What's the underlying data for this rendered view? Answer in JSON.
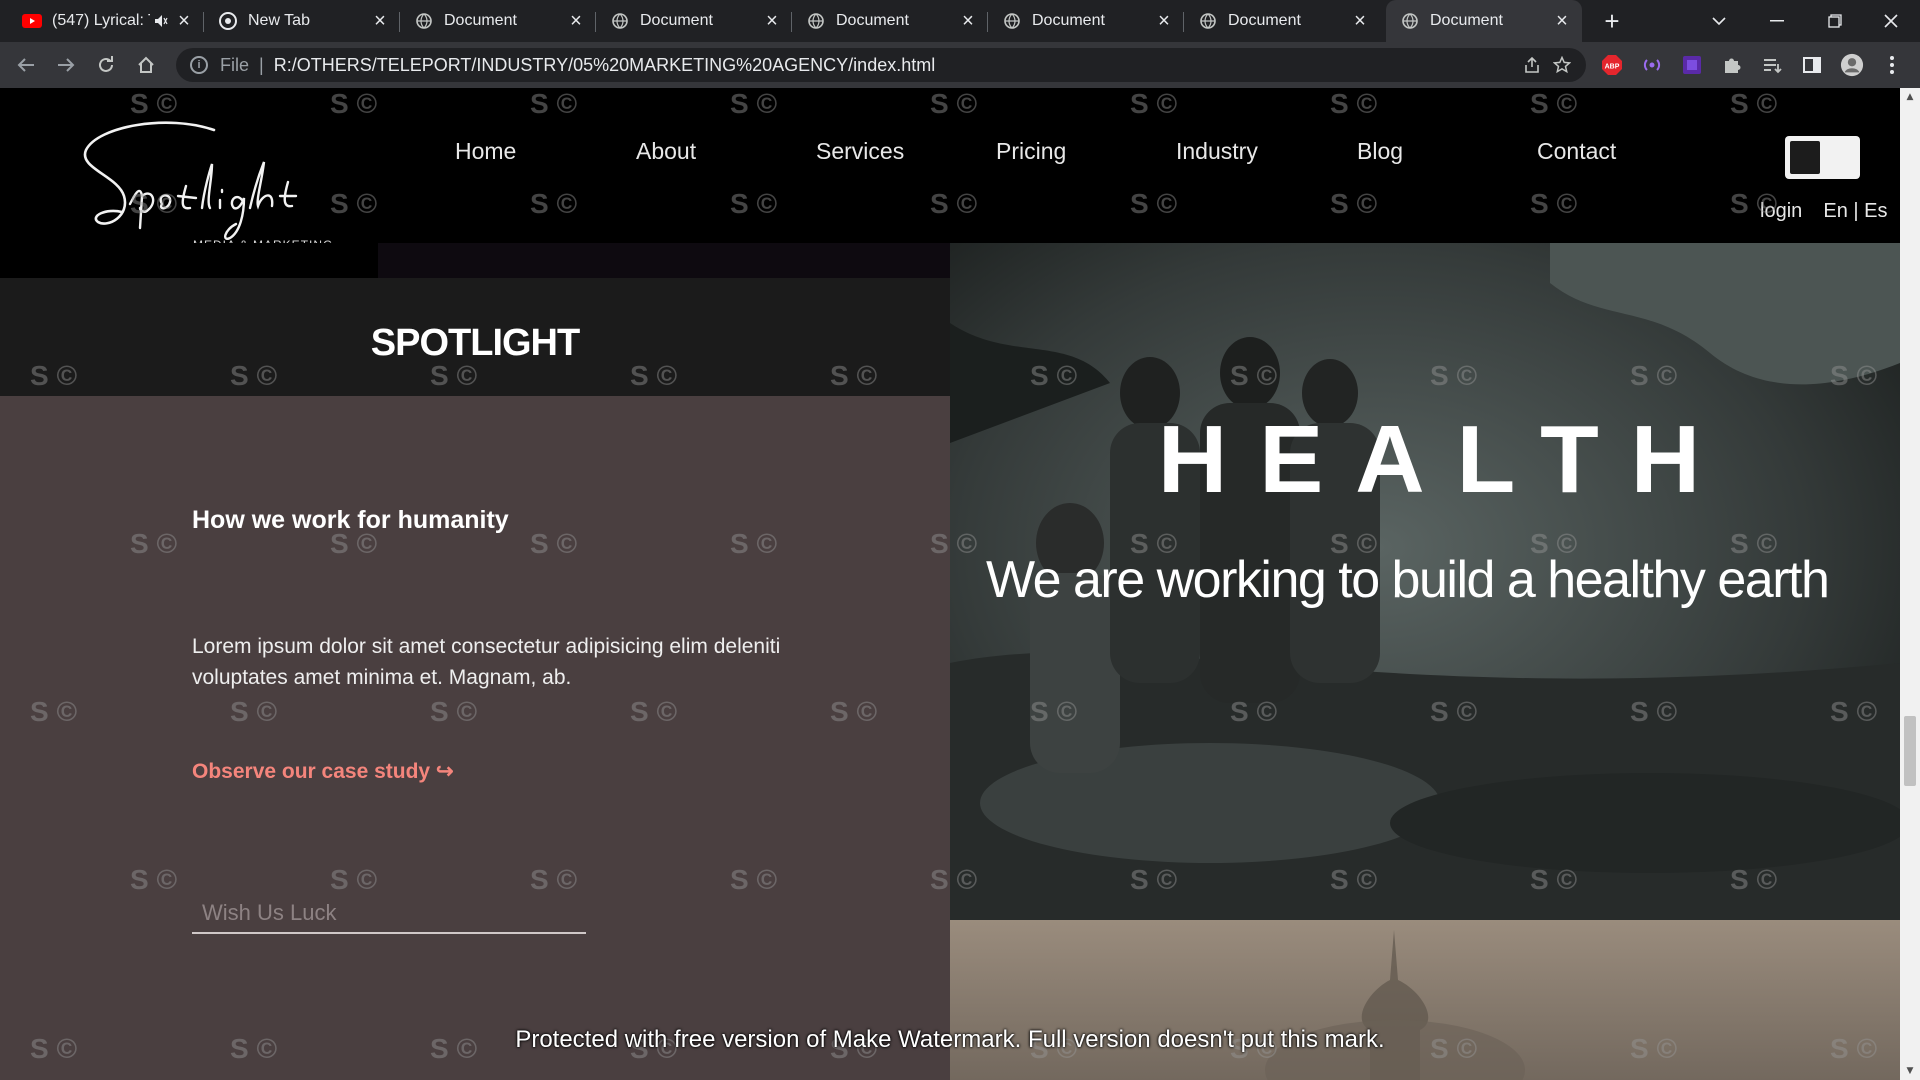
{
  "browser": {
    "tabs": [
      {
        "title": "(547) Lyrical: Te",
        "kind": "youtube"
      },
      {
        "title": "New Tab",
        "kind": "chrome"
      },
      {
        "title": "Document",
        "kind": "globe"
      },
      {
        "title": "Document",
        "kind": "globe"
      },
      {
        "title": "Document",
        "kind": "globe"
      },
      {
        "title": "Document",
        "kind": "globe"
      },
      {
        "title": "Document",
        "kind": "globe"
      },
      {
        "title": "Document",
        "kind": "globe"
      }
    ],
    "active_tab_index": 7,
    "address": {
      "scheme_label": "File",
      "separator": "|",
      "url": "R:/OTHERS/TELEPORT/INDUSTRY/05%20MARKETING%20AGENCY/index.html"
    },
    "extensions": [
      {
        "name": "adblock-plus-icon",
        "label": "ABP",
        "color": "#e5262d"
      },
      {
        "name": "broadcast-icon",
        "color": "#7b42d9"
      },
      {
        "name": "purple-extension-icon",
        "color": "#5a2aa8"
      },
      {
        "name": "puzzle-icon",
        "color": "#c4c7c5"
      }
    ]
  },
  "site": {
    "logo_script": "Spotlight",
    "logo_sub": "MEDIA & MARKETING",
    "nav": [
      "Home",
      "About",
      "Services",
      "Pricing",
      "Industry",
      "Blog",
      "Contact"
    ],
    "login": "login",
    "lang": "En | Es",
    "spotlight_title": "SPOTLIGHT",
    "section": {
      "heading": "How we work for humanity",
      "body": "Lorem ipsum dolor sit amet consectetur adipisicing elim deleniti voluptates amet minima et. Magnam, ab.",
      "link": "Observe our case study ↪",
      "input_placeholder": "Wish Us Luck"
    },
    "hero": {
      "title": "HEALTH",
      "subtitle": "We are working to build a healthy earth"
    }
  },
  "watermark": {
    "mark": "S ©",
    "banner": "Protected with free version of Make Watermark. Full version doesn't put this mark."
  },
  "colors": {
    "accent_link": "#f4857c",
    "panel_bg": "#4a3f40",
    "band_bg": "#1b1b1b"
  }
}
